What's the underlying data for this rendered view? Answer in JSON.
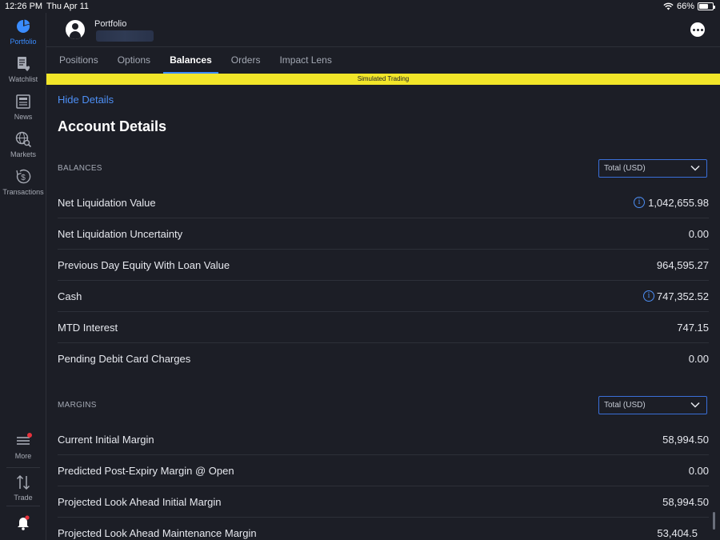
{
  "status_bar": {
    "time": "12:26 PM",
    "date": "Thu Apr 11",
    "battery": "66%",
    "battery_level": 0.66
  },
  "rail": {
    "items": [
      {
        "label": "Portfolio",
        "icon": "pie-chart-icon",
        "active": true
      },
      {
        "label": "Watchlist",
        "icon": "watchlist-icon",
        "active": false
      },
      {
        "label": "News",
        "icon": "newspaper-icon",
        "active": false
      },
      {
        "label": "Markets",
        "icon": "globe-search-icon",
        "active": false
      },
      {
        "label": "Transactions",
        "icon": "dollar-history-icon",
        "active": false
      }
    ],
    "more_label": "More",
    "trade_label": "Trade"
  },
  "header": {
    "title": "Portfolio"
  },
  "tabs": [
    {
      "label": "Positions"
    },
    {
      "label": "Options"
    },
    {
      "label": "Balances",
      "active": true
    },
    {
      "label": "Orders"
    },
    {
      "label": "Impact Lens"
    }
  ],
  "banner": "Simulated Trading",
  "colors": {
    "accent": "#3a8cff",
    "banner": "#f2e629",
    "background": "#1c1e26"
  },
  "details": {
    "hide_label": "Hide Details",
    "title": "Account Details",
    "balances": {
      "label": "BALANCES",
      "select": "Total (USD)",
      "rows": [
        {
          "label": "Net Liquidation Value",
          "value": "1,042,655.98",
          "info": true
        },
        {
          "label": "Net Liquidation Uncertainty",
          "value": "0.00"
        },
        {
          "label": "Previous Day Equity With Loan Value",
          "value": "964,595.27"
        },
        {
          "label": "Cash",
          "value": "747,352.52",
          "info": true
        },
        {
          "label": "MTD Interest",
          "value": "747.15"
        },
        {
          "label": "Pending Debit Card Charges",
          "value": "0.00"
        }
      ]
    },
    "margins": {
      "label": "MARGINS",
      "select": "Total (USD)",
      "rows": [
        {
          "label": "Current Initial Margin",
          "value": "58,994.50"
        },
        {
          "label": "Predicted Post-Expiry Margin @ Open",
          "value": "0.00"
        },
        {
          "label": "Projected Look Ahead Initial Margin",
          "value": "58,994.50"
        },
        {
          "label": "Projected Look Ahead Maintenance Margin",
          "value": "53,404.5"
        }
      ]
    }
  }
}
